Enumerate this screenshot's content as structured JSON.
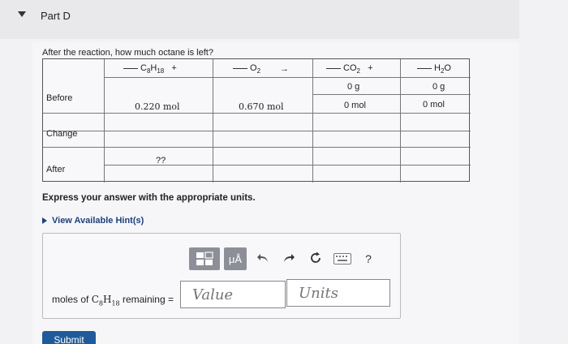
{
  "part": {
    "title": "Part D"
  },
  "question": "After the reaction, how much octane is left?",
  "table": {
    "columns": {
      "c8h18": "C8H18 +",
      "o2": "O2",
      "arrow": "→",
      "co2": "CO2 +",
      "h2o": "H2O"
    },
    "rows": {
      "before": {
        "label": "Before",
        "c8h18": "0.220 mol",
        "o2": "0.670 mol",
        "co2_g": "0 g",
        "co2_mol": "0 mol",
        "h2o_g": "0 g",
        "h2o_mol": "0 mol"
      },
      "change": {
        "label": "Change"
      },
      "after": {
        "label": "After",
        "c8h18": "??"
      }
    }
  },
  "instruction": "Express your answer with the appropriate units.",
  "hints": {
    "label": "View Available Hint(s)"
  },
  "toolbar": {
    "template_icon": "template-icon",
    "units_label": "μÅ",
    "undo_icon": "undo-icon",
    "redo_icon": "redo-icon",
    "reset_icon": "reset-icon",
    "keyboard_icon": "keyboard-icon",
    "help_label": "?"
  },
  "answer": {
    "label": "moles of C8H18 remaining =",
    "value_placeholder": "Value",
    "units_placeholder": "Units"
  },
  "submit": {
    "label": "Submit"
  }
}
